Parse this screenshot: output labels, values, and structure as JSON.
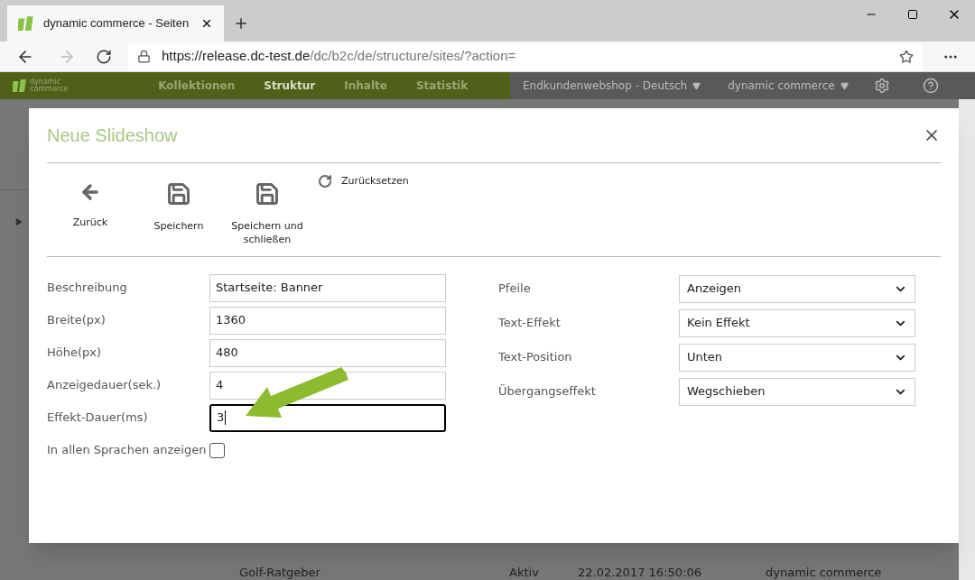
{
  "browser": {
    "tab_title": "dynamic commerce - Seiten",
    "url_host": "https://release.dc-test.de",
    "url_path": "/dc/b2c/de/structure/sites/?action="
  },
  "nav": {
    "logo_line1": "dynamic",
    "logo_line2": "commerce",
    "items": [
      {
        "label": "Kollektionen",
        "selected": false
      },
      {
        "label": "Struktur",
        "selected": true
      },
      {
        "label": "Inhalte",
        "selected": false
      },
      {
        "label": "Statistik",
        "selected": false
      }
    ],
    "shop": "Endkundenwebshop - Deutsch",
    "account": "dynamic commerce"
  },
  "background_rows": [
    {
      "name": "Golf-Ratgeber",
      "status": "Aktiv",
      "date": "22.02.2017 16:50:06",
      "owner": "dynamic commerce"
    }
  ],
  "dialog": {
    "title": "Neue Slideshow",
    "toolbar": [
      {
        "kind": "back",
        "label": "Zurück"
      },
      {
        "kind": "save",
        "label": "Speichern"
      },
      {
        "kind": "save",
        "label": "Speichern und schließen"
      }
    ],
    "reset": "Zurücksetzen",
    "left_fields": [
      {
        "kind": "text",
        "label": "Beschreibung",
        "value": "Startseite: Banner",
        "focused": false
      },
      {
        "kind": "text",
        "label": "Breite(px)",
        "value": "1360",
        "focused": false
      },
      {
        "kind": "text",
        "label": "Höhe(px)",
        "value": "480",
        "focused": false
      },
      {
        "kind": "text",
        "label": "Anzeigedauer(sek.)",
        "value": "4",
        "focused": false
      },
      {
        "kind": "text",
        "label": "Effekt-Dauer(ms)",
        "value": "3",
        "focused": true
      },
      {
        "kind": "checkbox",
        "label": "In allen Sprachen anzeigen",
        "checked": false
      }
    ],
    "right_fields": [
      {
        "label": "Pfeile",
        "value": "Anzeigen"
      },
      {
        "label": "Text-Effekt",
        "value": "Kein Effekt"
      },
      {
        "label": "Text-Position",
        "value": "Unten"
      },
      {
        "label": "Übergangseffekt",
        "value": "Wegschieben"
      }
    ]
  }
}
